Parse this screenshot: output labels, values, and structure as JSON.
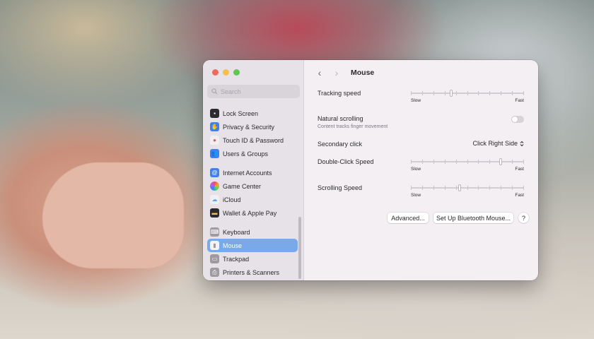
{
  "window": {
    "traffic_lights": {
      "close": "#ed6a5e",
      "minimize": "#f5bf4f",
      "zoom": "#61c554"
    }
  },
  "search": {
    "placeholder": "Search",
    "icon": "search-icon"
  },
  "sidebar": {
    "items": [
      {
        "label": "Lock Screen",
        "icon": "lock-icon",
        "color": "#2b2b2e"
      },
      {
        "label": "Privacy & Security",
        "icon": "hand-icon",
        "color": "#3b82f6"
      },
      {
        "label": "Touch ID & Password",
        "icon": "fingerprint-icon",
        "color": "#f0f0f0"
      },
      {
        "label": "Users & Groups",
        "icon": "users-icon",
        "color": "#3b82f6"
      },
      {
        "label": "Internet Accounts",
        "icon": "at-icon",
        "color": "#3b82f6"
      },
      {
        "label": "Game Center",
        "icon": "game-center-icon",
        "color": "#f0f0f0"
      },
      {
        "label": "iCloud",
        "icon": "cloud-icon",
        "color": "#f0f0f0"
      },
      {
        "label": "Wallet & Apple Pay",
        "icon": "wallet-icon",
        "color": "#2b2b2e"
      },
      {
        "label": "Keyboard",
        "icon": "keyboard-icon",
        "color": "#9e9aa0"
      },
      {
        "label": "Mouse",
        "icon": "mouse-icon",
        "color": "#9e9aa0",
        "selected": true
      },
      {
        "label": "Trackpad",
        "icon": "trackpad-icon",
        "color": "#9e9aa0"
      },
      {
        "label": "Printers & Scanners",
        "icon": "printer-icon",
        "color": "#9e9aa0"
      }
    ]
  },
  "main": {
    "title": "Mouse",
    "tracking_speed": {
      "label": "Tracking speed",
      "min_label": "Slow",
      "max_label": "Fast",
      "value": 0.35
    },
    "natural_scrolling": {
      "label": "Natural scrolling",
      "description": "Content tracks finger movement",
      "enabled": false
    },
    "secondary_click": {
      "label": "Secondary click",
      "value": "Click Right Side"
    },
    "double_click_speed": {
      "label": "Double-Click Speed",
      "min_label": "Slow",
      "max_label": "Fast",
      "value": 0.8
    },
    "scrolling_speed": {
      "label": "Scrolling Speed",
      "min_label": "Slow",
      "max_label": "Fast",
      "value": 0.43
    },
    "buttons": {
      "advanced": "Advanced...",
      "bluetooth": "Set Up Bluetooth Mouse...",
      "help": "?"
    }
  }
}
